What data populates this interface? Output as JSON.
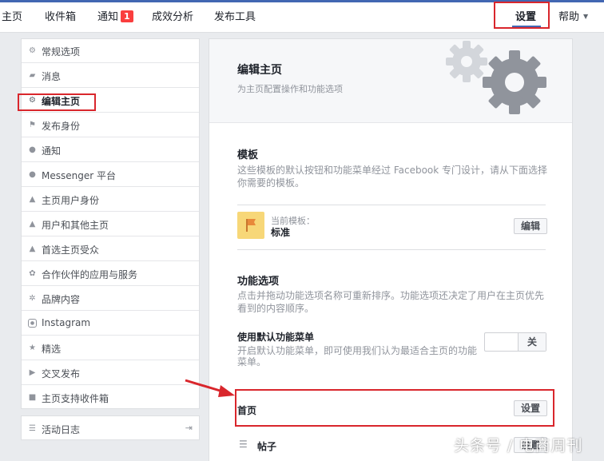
{
  "topnav": {
    "items": [
      "主页",
      "收件箱",
      "通知",
      "成效分析",
      "发布工具"
    ],
    "notification_count": "1",
    "settings_label": "设置",
    "help_label": "帮助"
  },
  "sidebar": {
    "items": [
      {
        "label": "常规选项",
        "icon": "gear-icon"
      },
      {
        "label": "消息",
        "icon": "chat-icon"
      },
      {
        "label": "编辑主页",
        "icon": "gear-icon"
      },
      {
        "label": "发布身份",
        "icon": "flag-icon"
      },
      {
        "label": "通知",
        "icon": "globe-icon"
      },
      {
        "label": "Messenger 平台",
        "icon": "messenger-icon"
      },
      {
        "label": "主页用户身份",
        "icon": "person-icon"
      },
      {
        "label": "用户和其他主页",
        "icon": "people-icon"
      },
      {
        "label": "首选主页受众",
        "icon": "people-icon"
      },
      {
        "label": "合作伙伴的应用与服务",
        "icon": "apps-icon"
      },
      {
        "label": "品牌内容",
        "icon": "handshake-icon"
      },
      {
        "label": "Instagram",
        "icon": "instagram-icon"
      },
      {
        "label": "精选",
        "icon": "star-icon"
      },
      {
        "label": "交叉发布",
        "icon": "video-icon"
      },
      {
        "label": "主页支持收件箱",
        "icon": "inbox-icon"
      }
    ],
    "activity_log": "活动日志"
  },
  "main": {
    "header_title": "编辑主页",
    "header_subtitle": "为主页配置操作和功能选项",
    "template_title": "模板",
    "template_desc": "这些模板的默认按钮和功能菜单经过 Facebook 专门设计，请从下面选择你需要的模板。",
    "current_template_label": "当前模板：",
    "current_template_value": "标准",
    "edit_button": "编辑",
    "tabs_title": "功能选项",
    "tabs_desc": "点击并拖动功能选项名称可重新排序。功能选项还决定了用户在主页优先看到的内容顺序。",
    "default_tabs_title": "使用默认功能菜单",
    "default_tabs_desc": "开启默认功能菜单，即可使用我们认为最适合主页的功能菜单。",
    "toggle_label": "关",
    "tab_rows": [
      {
        "label": "首页",
        "button": "设置"
      },
      {
        "label": "帖子",
        "button": "设置"
      }
    ]
  },
  "watermark": "头条号 / 电商周刊",
  "colors": {
    "accent": "#4267b2",
    "annotation_red": "#d9262c",
    "badge_red": "#fa3e3e"
  }
}
